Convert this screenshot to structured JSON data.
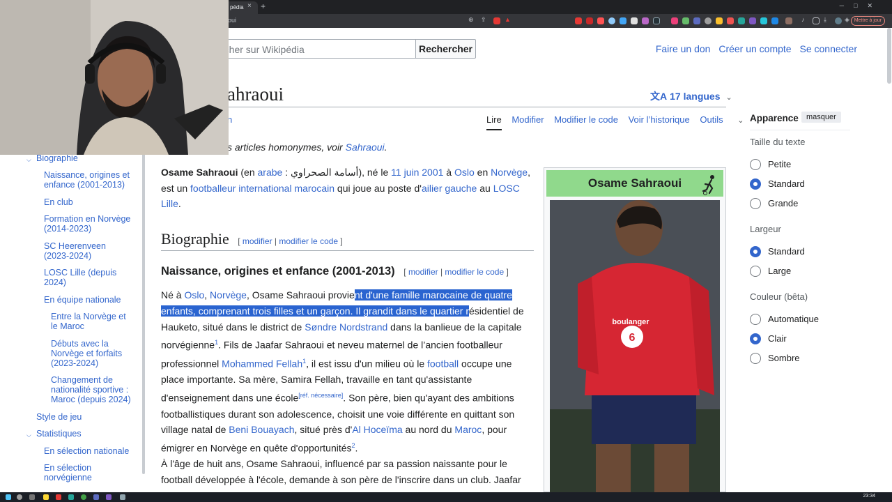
{
  "browser": {
    "tab_title": "pédia",
    "url_fragment": "oui",
    "update_button": "Mettre à jour",
    "colors": {
      "tabstrip": "#202124",
      "toolbar": "#35363a"
    }
  },
  "header": {
    "search_placeholder": "rcher sur Wikipédia",
    "search_button": "Rechercher",
    "user_links": [
      "Faire un don",
      "Créer un compte",
      "Se connecter"
    ]
  },
  "page": {
    "title_fragment": "ahraoui",
    "languages": "17 langues",
    "tab_fragment": "n",
    "view_tabs": [
      "Lire",
      "Modifier",
      "Modifier le code",
      "Voir l’historique"
    ],
    "tools": "Outils",
    "homonym_prefix": "s articles homonymes, voir ",
    "homonym_link": "Sahraoui",
    "homonym_suffix": "."
  },
  "toc": {
    "items": [
      {
        "label": "Biographie",
        "level": 1,
        "expanded": true
      },
      {
        "label": "Naissance, origines et enfance (2001-2013)",
        "level": 2
      },
      {
        "label": "En club",
        "level": 2
      },
      {
        "label": "Formation en Norvège (2014-2023)",
        "level": 2
      },
      {
        "label": "SC Heerenveen (2023-2024)",
        "level": 2
      },
      {
        "label": "LOSC Lille (depuis 2024)",
        "level": 2
      },
      {
        "label": "En équipe nationale",
        "level": 2
      },
      {
        "label": "Entre la Norvège et le Maroc",
        "level": 3
      },
      {
        "label": "Débuts avec la Norvège et forfaits (2023-2024)",
        "level": 3
      },
      {
        "label": "Changement de nationalité sportive : Maroc (depuis 2024)",
        "level": 3
      },
      {
        "label": "Style de jeu",
        "level": 1
      },
      {
        "label": "Statistiques",
        "level": 1,
        "expanded": true
      },
      {
        "label": "En sélection nationale",
        "level": 2
      },
      {
        "label": "En sélection norvégienne",
        "level": 2
      }
    ]
  },
  "article": {
    "lead": {
      "name": "Osame Sahraoui",
      "t1": " (en ",
      "arabe": "arabe",
      "t2": " : أسامة الصحراوي), né le ",
      "date": "11 juin 2001",
      "t3": " à ",
      "oslo": "Oslo",
      "t4": " en ",
      "norvege": "Norvège",
      "t5": ", est un ",
      "footballeur": "footballeur international marocain",
      "t6": " qui joue au poste d'",
      "ailier": "ailier gauche",
      "t7": " au ",
      "losc": "LOSC Lille",
      "t8": "."
    },
    "h2": "Biographie",
    "edit": "modifier",
    "edit_code": "modifier le code",
    "h3": "Naissance, origines et enfance (2001-2013)",
    "para2": {
      "a": "Né à ",
      "oslo": "Oslo",
      "b": ", ",
      "norvege": "Norvège",
      "c": ", Osame Sahraoui provie",
      "hl": "nt d'une famille marocaine de quatre enfants, comprenant trois filles et un garçon. Il grandit dans le quartier r",
      "d": "ésidentiel de Hauketo, situé dans le district de ",
      "sondre": "Søndre Nordstrand",
      "e": " dans la banlieue de la capitale norvégienne",
      "ref1": "1",
      "f": ". Fils de Jaafar Sahraoui et neveu maternel de l’ancien footballeur professionnel ",
      "fellah": "Mohammed Fellah",
      "ref1b": "1",
      "g": ", il est issu d'un milieu où le ",
      "football": "football",
      "h": " occupe une place importante. Sa mère, Samira Fellah, travaille en tant qu'assistante d'enseignement dans une école",
      "refn": "[réf. nécessaire]",
      "i": ". Son père, bien qu'ayant des ambitions footballistiques durant son adolescence, choisit une voie différente en quittant son village natal de ",
      "beni": "Beni Bouayach",
      "j": ", situé près d'",
      "alho": "Al Hoceïma",
      "k": " au nord du ",
      "maroc": "Maroc",
      "l": ", pour émigrer en Norvège en quête d'opportunités",
      "ref2": "2",
      "m": "."
    },
    "para3": "À l'âge de huit ans, Osame Sahraoui, influencé par sa passion naissante pour le football développée à l'école, demande à son père de l'inscrire dans un club. Jaafar"
  },
  "infobox": {
    "name": "Osame Sahraoui",
    "header_color": "#90d98c",
    "photo_text": "boulanger"
  },
  "appearance": {
    "title": "Apparence",
    "hide": "masquer",
    "text_size_label": "Taille du texte",
    "text_size_options": [
      "Petite",
      "Standard",
      "Grande"
    ],
    "text_size_selected": 1,
    "width_label": "Largeur",
    "width_options": [
      "Standard",
      "Large"
    ],
    "width_selected": 0,
    "color_label": "Couleur (bêta)",
    "color_options": [
      "Automatique",
      "Clair",
      "Sombre"
    ],
    "color_selected": 1
  },
  "taskbar": {
    "clock": "23:34"
  }
}
